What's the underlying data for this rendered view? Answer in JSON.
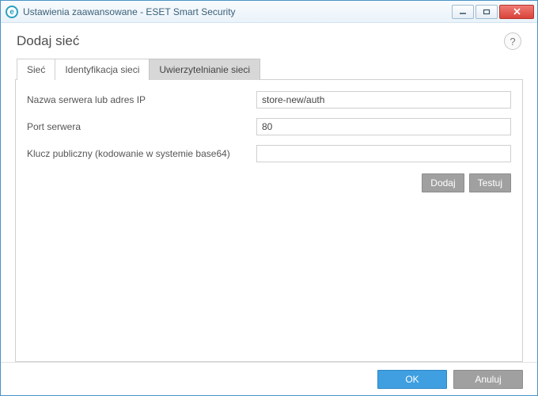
{
  "window": {
    "title": "Ustawienia zaawansowane - ESET Smart Security",
    "icon_letter": "e"
  },
  "header": {
    "title": "Dodaj sieć"
  },
  "tabs": {
    "items": [
      {
        "label": "Sieć"
      },
      {
        "label": "Identyfikacja sieci"
      },
      {
        "label": "Uwierzytelnianie sieci"
      }
    ]
  },
  "form": {
    "server_label": "Nazwa serwera lub adres IP",
    "server_value": "store-new/auth",
    "port_label": "Port serwera",
    "port_value": "80",
    "pubkey_label": "Klucz publiczny (kodowanie w systemie base64)",
    "pubkey_value": ""
  },
  "buttons": {
    "add": "Dodaj",
    "test": "Testuj"
  },
  "footer": {
    "ok": "OK",
    "cancel": "Anuluj"
  }
}
